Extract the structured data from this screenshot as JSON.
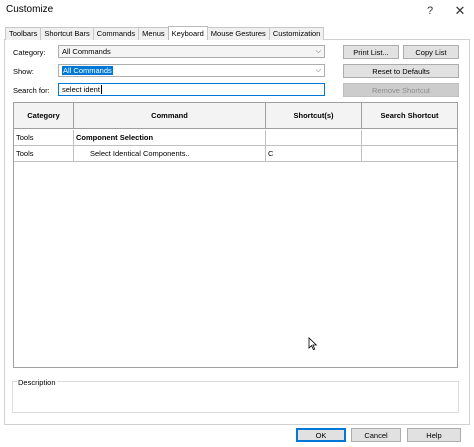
{
  "window": {
    "title": "Customize",
    "help_glyph": "?",
    "close_glyph": "✕"
  },
  "tabs": [
    {
      "label": "Toolbars",
      "active": false
    },
    {
      "label": "Shortcut Bars",
      "active": false
    },
    {
      "label": "Commands",
      "active": false
    },
    {
      "label": "Menus",
      "active": false
    },
    {
      "label": "Keyboard",
      "active": true
    },
    {
      "label": "Mouse Gestures",
      "active": false
    },
    {
      "label": "Customization",
      "active": false
    }
  ],
  "filters": {
    "category_label": "Category:",
    "category_value": "All Commands",
    "show_label": "Show:",
    "show_value": "All Commands",
    "search_label": "Search for:",
    "search_value": "select ident"
  },
  "buttons": {
    "print_list": "Print List...",
    "copy_list": "Copy List",
    "reset_defaults": "Reset to Defaults",
    "remove_shortcut": "Remove Shortcut"
  },
  "table": {
    "headers": [
      "Category",
      "Command",
      "Shortcut(s)",
      "Search Shortcut"
    ],
    "rows": [
      {
        "category": "Tools",
        "command": "Component Selection",
        "shortcut": "",
        "search_shortcut": "",
        "group": true
      },
      {
        "category": "Tools",
        "command": "Select Identical Components..",
        "shortcut": "C",
        "search_shortcut": "",
        "group": false
      }
    ]
  },
  "description": {
    "label": "Description"
  },
  "footer": {
    "ok": "OK",
    "cancel": "Cancel",
    "help": "Help"
  },
  "icons": {
    "dropdown": "chevron-down-icon",
    "cursor": "mouse-pointer-icon"
  }
}
